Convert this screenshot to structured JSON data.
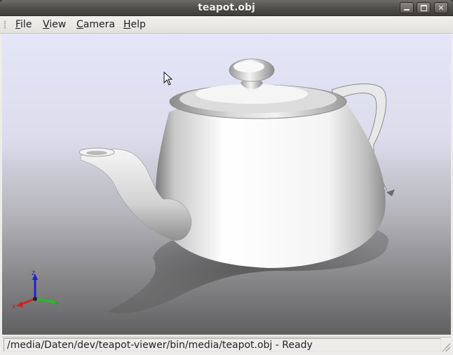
{
  "window": {
    "title": "teapot.obj"
  },
  "menu": {
    "file": {
      "mnemonic": "F",
      "rest": "ile"
    },
    "view": {
      "mnemonic": "V",
      "rest": "iew"
    },
    "camera": {
      "mnemonic": "C",
      "rest": "amera"
    },
    "help": {
      "mnemonic": "H",
      "rest": "elp"
    }
  },
  "axes": {
    "z": "Z",
    "y": "Y",
    "x": "X",
    "colors": {
      "x": "#d42020",
      "y": "#20c020",
      "z": "#2020d8"
    }
  },
  "status": {
    "text": "/media/Daten/dev/teapot-viewer/bin/media/teapot.obj - Ready"
  },
  "icons": {
    "minimize": "minimize-icon",
    "maximize": "maximize-icon",
    "close": "close-icon",
    "cursor": "mouse-pointer-icon"
  }
}
